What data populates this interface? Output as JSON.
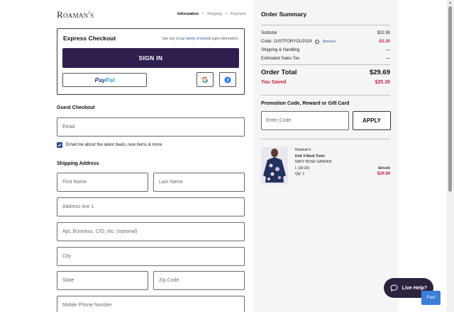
{
  "brand": {
    "logo_text": "Roaman's"
  },
  "breadcrumb": {
    "step1": "Information",
    "step2": "Shipping",
    "step3": "Payment",
    "separator": ">"
  },
  "express": {
    "title": "Express Checkout",
    "hint_prefix": "Use any of ",
    "hint_link": "our family of brands",
    "hint_suffix": " login information.",
    "signin_label": "SIGN IN",
    "paypal_pay": "Pay",
    "paypal_pal": "Pal"
  },
  "guest": {
    "title": "Guest Checkout",
    "email_placeholder": "Email",
    "optin_label": "Email me about the latest deals, new items & more.",
    "optin_checked": true
  },
  "shipping": {
    "title": "Shipping Address",
    "first_name": "First Name",
    "last_name": "Last Name",
    "address1": "Address line 1",
    "address2": "Apt, Business, C/O, etc. (optional)",
    "city": "City",
    "state": "State",
    "zip": "Zip Code",
    "phone": "Mobile Phone Number"
  },
  "summary": {
    "title": "Order Summary",
    "subtotal_label": "Subtotal",
    "subtotal_value": "$32.99",
    "code_label": "Code: JUSTFORYOU2024",
    "code_remove": "Remove",
    "code_value": "-$3.30",
    "shipping_label": "Shipping & Handling",
    "shipping_value": "—",
    "tax_label": "Estimated Sales Tax",
    "tax_value": "—",
    "total_label": "Order Total",
    "total_value": "$29.69",
    "saved_label": "You Saved",
    "saved_value": "$25.30"
  },
  "promo": {
    "title": "Promotion Code, Reward or Gift Card",
    "placeholder": "Enter Code",
    "apply_label": "APPLY"
  },
  "product": {
    "brand": "Roaman's",
    "name": "Knit V-Neck Tunic",
    "color": "NAVY ROSE GARDEN",
    "size": "L (18-20)",
    "qty": "Qty: 1",
    "price_original": "$54.99",
    "price_sale": "$29.69"
  },
  "chat": {
    "live_help_label": "Live Help?",
    "fast_label": "Fast"
  },
  "colors": {
    "accent": "#2f1f4e",
    "sale_red": "#c0273f",
    "link_blue": "#2c5aa0"
  }
}
